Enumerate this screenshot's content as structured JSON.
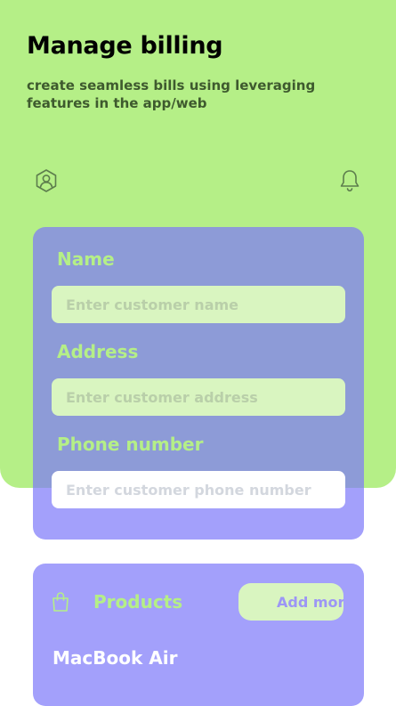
{
  "header": {
    "title": "Manage billing",
    "subtitle": "create seamless bills using leveraging features in the app/web"
  },
  "topbar": {
    "profile_icon": "user-hexagon-icon",
    "notification_icon": "bell-icon"
  },
  "form": {
    "name_label": "Name",
    "name_placeholder": "Enter customer name",
    "address_label": "Address",
    "address_placeholder": "Enter customer address",
    "phone_label": "Phone number",
    "phone_placeholder": "Enter customer phone number"
  },
  "products": {
    "icon": "shopping-bag-icon",
    "title": "Products",
    "add_label": "Add more",
    "items": [
      {
        "name": "MacBook Air"
      }
    ]
  },
  "colors": {
    "accent_green": "#b5ef87",
    "accent_purple": "#7c78fa",
    "field_bg": "#d9f5c0"
  }
}
